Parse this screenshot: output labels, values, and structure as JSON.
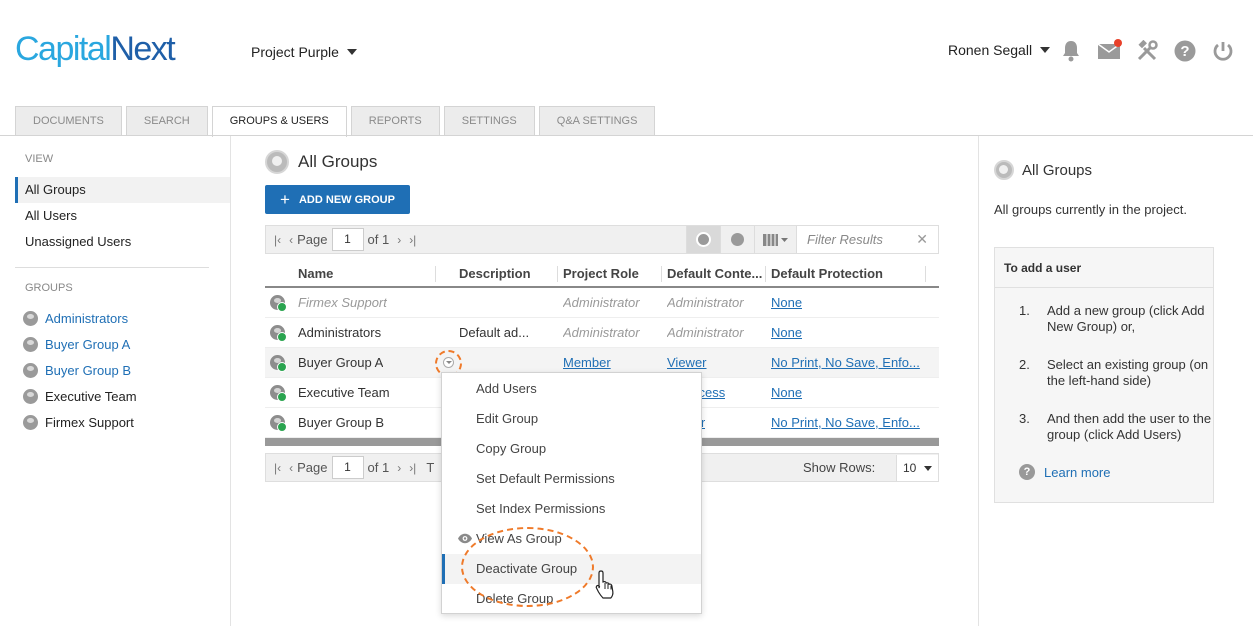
{
  "brand": {
    "part1": "Capital",
    "part2": "Next"
  },
  "header": {
    "project": "Project Purple",
    "user": "Ronen Segall"
  },
  "tabs": [
    {
      "label": "DOCUMENTS"
    },
    {
      "label": "SEARCH"
    },
    {
      "label": "GROUPS & USERS"
    },
    {
      "label": "REPORTS"
    },
    {
      "label": "SETTINGS"
    },
    {
      "label": "Q&A SETTINGS"
    }
  ],
  "sidebar": {
    "view_label": "VIEW",
    "views": [
      {
        "label": "All Groups"
      },
      {
        "label": "All Users"
      },
      {
        "label": "Unassigned Users"
      }
    ],
    "groups_label": "GROUPS",
    "groups": [
      {
        "label": "Administrators"
      },
      {
        "label": "Buyer Group A"
      },
      {
        "label": "Buyer Group B"
      },
      {
        "label": "Executive Team"
      },
      {
        "label": "Firmex Support"
      }
    ]
  },
  "main": {
    "title": "All Groups",
    "add_button": "ADD NEW GROUP",
    "pager": {
      "page_label": "Page",
      "page": "1",
      "of": "of 1"
    },
    "filter_placeholder": "Filter Results",
    "columns": [
      "Name",
      "Description",
      "Project Role",
      "Default Conte...",
      "Default Protection"
    ],
    "rows": [
      {
        "name": "Firmex Support",
        "description": "",
        "role": "Administrator",
        "content": "Administrator",
        "protection": "None"
      },
      {
        "name": "Administrators",
        "description": "Default ad...",
        "role": "Administrator",
        "content": "Administrator",
        "protection": "None"
      },
      {
        "name": "Buyer Group A",
        "description": "",
        "role": "Member",
        "content": "Viewer",
        "protection": "No Print, No Save, Enfo..."
      },
      {
        "name": "Executive Team",
        "description": "",
        "role": "",
        "content": "ccess",
        "protection": "None"
      },
      {
        "name": "Buyer Group B",
        "description": "",
        "role": "",
        "content": "r",
        "protection": "No Print, No Save, Enfo..."
      }
    ],
    "bottom_pager": {
      "page_label": "Page",
      "page": "1",
      "of": "of 1",
      "trail": "T"
    },
    "show_rows_label": "Show Rows:",
    "show_rows_value": "10"
  },
  "context_menu": {
    "items": [
      {
        "label": "Add Users"
      },
      {
        "label": "Edit Group"
      },
      {
        "label": "Copy Group"
      },
      {
        "label": "Set Default Permissions"
      },
      {
        "label": "Set Index Permissions"
      },
      {
        "label": "View As Group"
      },
      {
        "label": "Deactivate Group"
      },
      {
        "label": "Delete Group"
      }
    ]
  },
  "right_panel": {
    "title": "All Groups",
    "description": "All groups currently in the project.",
    "box_title": "To add a user",
    "steps": [
      {
        "num": "1.",
        "text": "Add a new group (click Add New Group) or,"
      },
      {
        "num": "2.",
        "text": "Select an existing group (on the left-hand side)"
      },
      {
        "num": "3.",
        "text": "And then add the user to the group (click Add Users)"
      }
    ],
    "learn_more": "Learn more"
  },
  "colors": {
    "accent": "#1f6fb5",
    "logo_light": "#2aa7df",
    "highlight_ring": "#ef7a2a",
    "notification": "#e8412a"
  },
  "icons": [
    "bell-icon",
    "mail-icon",
    "tools-icon",
    "help-icon",
    "power-icon",
    "eye-icon",
    "pointer-hand-icon"
  ]
}
